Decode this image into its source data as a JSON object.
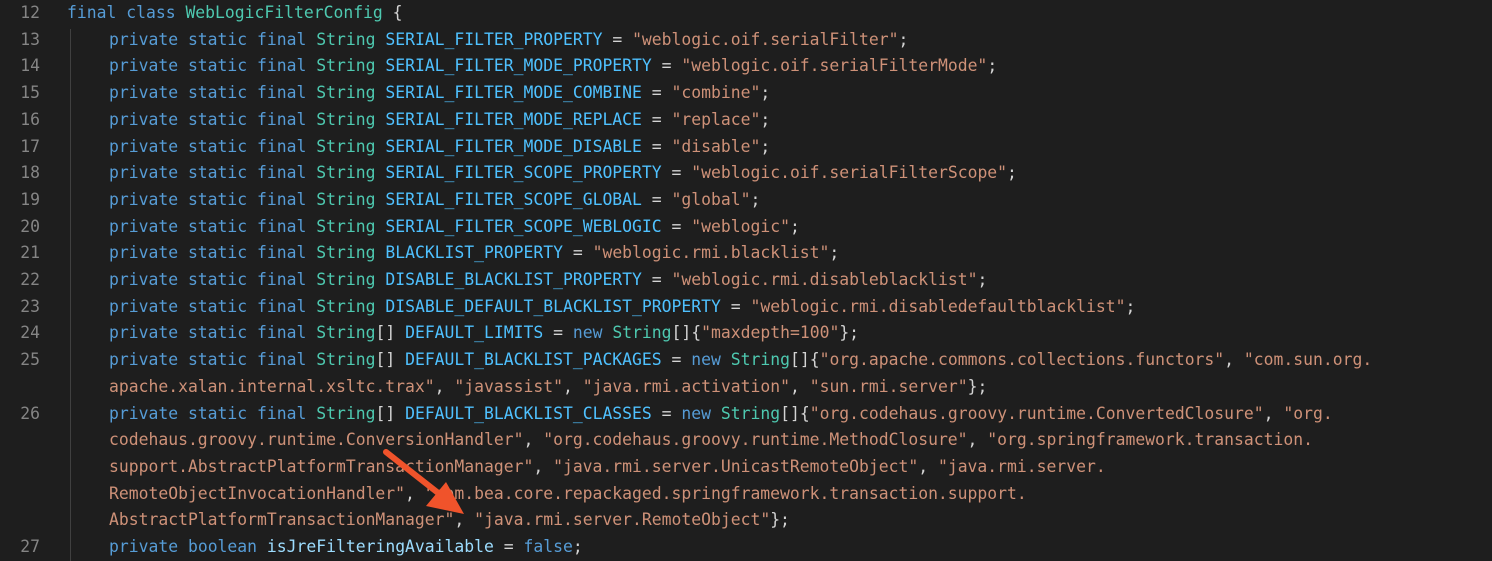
{
  "lines": [
    {
      "num": "12",
      "t": [
        "final",
        " ",
        "class",
        " ",
        "WebLogicFilterConfig",
        " {"
      ]
    },
    {
      "num": "13",
      "t": [
        "private static final",
        " ",
        "String",
        " ",
        "SERIAL_FILTER_PROPERTY",
        " = ",
        "\"weblogic.oif.serialFilter\"",
        ";"
      ]
    },
    {
      "num": "14",
      "t": [
        "private static final",
        " ",
        "String",
        " ",
        "SERIAL_FILTER_MODE_PROPERTY",
        " = ",
        "\"weblogic.oif.serialFilterMode\"",
        ";"
      ]
    },
    {
      "num": "15",
      "t": [
        "private static final",
        " ",
        "String",
        " ",
        "SERIAL_FILTER_MODE_COMBINE",
        " = ",
        "\"combine\"",
        ";"
      ]
    },
    {
      "num": "16",
      "t": [
        "private static final",
        " ",
        "String",
        " ",
        "SERIAL_FILTER_MODE_REPLACE",
        " = ",
        "\"replace\"",
        ";"
      ]
    },
    {
      "num": "17",
      "t": [
        "private static final",
        " ",
        "String",
        " ",
        "SERIAL_FILTER_MODE_DISABLE",
        " = ",
        "\"disable\"",
        ";"
      ]
    },
    {
      "num": "18",
      "t": [
        "private static final",
        " ",
        "String",
        " ",
        "SERIAL_FILTER_SCOPE_PROPERTY",
        " = ",
        "\"weblogic.oif.serialFilterScope\"",
        ";"
      ]
    },
    {
      "num": "19",
      "t": [
        "private static final",
        " ",
        "String",
        " ",
        "SERIAL_FILTER_SCOPE_GLOBAL",
        " = ",
        "\"global\"",
        ";"
      ]
    },
    {
      "num": "20",
      "t": [
        "private static final",
        " ",
        "String",
        " ",
        "SERIAL_FILTER_SCOPE_WEBLOGIC",
        " = ",
        "\"weblogic\"",
        ";"
      ]
    },
    {
      "num": "21",
      "t": [
        "private static final",
        " ",
        "String",
        " ",
        "BLACKLIST_PROPERTY",
        " = ",
        "\"weblogic.rmi.blacklist\"",
        ";"
      ]
    },
    {
      "num": "22",
      "t": [
        "private static final",
        " ",
        "String",
        " ",
        "DISABLE_BLACKLIST_PROPERTY",
        " = ",
        "\"weblogic.rmi.disableblacklist\"",
        ";"
      ]
    },
    {
      "num": "23",
      "t": [
        "private static final",
        " ",
        "String",
        " ",
        "DISABLE_DEFAULT_BLACKLIST_PROPERTY",
        " = ",
        "\"weblogic.rmi.disabledefaultblacklist\"",
        ";"
      ]
    },
    {
      "num": "24",
      "t": [
        "private static final",
        " ",
        "String",
        "[] ",
        "DEFAULT_LIMITS",
        " = ",
        "new",
        " ",
        "String",
        "[]{",
        "\"maxdepth=100\"",
        "};"
      ]
    },
    {
      "num": "25",
      "t": [
        "private static final",
        " ",
        "String",
        "[] ",
        "DEFAULT_BLACKLIST_PACKAGES",
        " = ",
        "new",
        " ",
        "String",
        "[]{",
        "\"org.apache.commons.collections.functors\"",
        ", ",
        "\"com.sun.org."
      ]
    },
    {
      "num": "",
      "t": [
        "apache.xalan.internal.xsltc.trax\"",
        ", ",
        "\"javassist\"",
        ", ",
        "\"java.rmi.activation\"",
        ", ",
        "\"sun.rmi.server\"",
        "};"
      ]
    },
    {
      "num": "26",
      "t": [
        "private static final",
        " ",
        "String",
        "[] ",
        "DEFAULT_BLACKLIST_CLASSES",
        " = ",
        "new",
        " ",
        "String",
        "[]{",
        "\"org.codehaus.groovy.runtime.ConvertedClosure\"",
        ", ",
        "\"org."
      ]
    },
    {
      "num": "",
      "t": [
        "codehaus.groovy.runtime.ConversionHandler\"",
        ", ",
        "\"org.codehaus.groovy.runtime.MethodClosure\"",
        ", ",
        "\"org.springframework.transaction."
      ]
    },
    {
      "num": "",
      "t": [
        "support.AbstractPlatformTransactionManager\"",
        ", ",
        "\"java.rmi.server.UnicastRemoteObject\"",
        ", ",
        "\"java.rmi.server."
      ]
    },
    {
      "num": "",
      "t": [
        "RemoteObjectInvocationHandler\"",
        ", ",
        "\"com.bea.core.repackaged.springframework.transaction.support."
      ]
    },
    {
      "num": "",
      "t": [
        "AbstractPlatformTransactionManager\"",
        ", ",
        "\"java.rmi.server.RemoteObject\"",
        "};"
      ]
    },
    {
      "num": "27",
      "t": [
        "private",
        " ",
        "boolean",
        " ",
        "isJreFilteringAvailable",
        " = ",
        "false",
        ";"
      ]
    }
  ],
  "colors": {
    "background": "#1e1e1e",
    "keyword": "#569cd6",
    "type": "#4ec9b0",
    "constant": "#4fc1ff",
    "string": "#ce9178",
    "identifier": "#9cdcfe",
    "line_number": "#858585",
    "arrow": "#f0532b"
  },
  "annotation": {
    "icon": "arrow-icon"
  }
}
